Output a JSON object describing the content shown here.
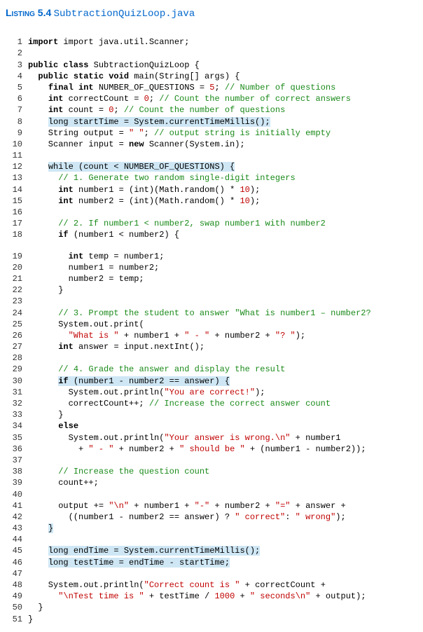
{
  "header": {
    "label": "Listing 5.4",
    "file": "SubtractionQuizLoop.java"
  },
  "lines": {
    "l1": "import java.util.Scanner;",
    "l3": "public class SubtractionQuizLoop {",
    "l4": "public static void main(String[] args) {",
    "l5a": "final int NUMBER_OF_QUESTIONS = ",
    "l5b": "5",
    "l5c": "; ",
    "l5d": "// Number of questions",
    "l6a": "int correctCount = ",
    "l6b": "0",
    "l6c": "; ",
    "l6d": "// Count the number of correct answers",
    "l7a": "int count = ",
    "l7b": "0",
    "l7c": "; ",
    "l7d": "// Count the number of questions",
    "l8": "long startTime = System.currentTimeMillis();",
    "l9a": "String output = ",
    "l9b": "\" \"",
    "l9c": "; ",
    "l9d": "// output string is initially empty",
    "l10a": "Scanner input = ",
    "l10b": "new",
    "l10c": " Scanner(System.in);",
    "l12": "while (count < NUMBER_OF_QUESTIONS) {",
    "l13": "// 1. Generate two random single-digit integers",
    "l14a": "int number1 = (int)(Math.random() * ",
    "l14b": "10",
    "l14c": ");",
    "l15a": "int number2 = (int)(Math.random() * ",
    "l15b": "10",
    "l15c": ");",
    "l17": "// 2. If number1 < number2, swap number1 with number2",
    "l18a": "if",
    "l18b": " (number1 < number2) {",
    "l19": "int temp = number1;",
    "l20": "number1 = number2;",
    "l21": "number2 = temp;",
    "l22": "}",
    "l24": "// 3. Prompt the student to answer \"What is number1 – number2?",
    "l25": "System.out.print(",
    "l26a": "\"What is \"",
    "l26b": " + number1 + ",
    "l26c": "\" - \"",
    "l26d": " + number2 + ",
    "l26e": "\"? \"",
    "l26f": ");",
    "l27": "int answer = input.nextInt();",
    "l29": "// 4. Grade the answer and display the result",
    "l30a": "if",
    "l30b": " (number1 - number2 == answer) {",
    "l31a": "System.out.println(",
    "l31b": "\"You are correct!\"",
    "l31c": ");",
    "l32a": "correctCount++; ",
    "l32b": "// Increase the correct answer count",
    "l33": "}",
    "l34": "else",
    "l35a": "System.out.println(",
    "l35b": "\"Your answer is wrong.\\n\"",
    "l35c": " + number1",
    "l36a": "+ ",
    "l36b": "\" - \"",
    "l36c": " + number2 + ",
    "l36d": "\" should be \"",
    "l36e": " + (number1 - number2));",
    "l38": "// Increase the question count",
    "l39": "count++;",
    "l41a": "output += ",
    "l41b": "\"\\n\"",
    "l41c": " + number1 + ",
    "l41d": "\"-\"",
    "l41e": " + number2 + ",
    "l41f": "\"=\"",
    "l41g": " + answer +",
    "l42a": "((number1 - number2 == answer) ? ",
    "l42b": "\" correct\"",
    "l42c": ": ",
    "l42d": "\" wrong\"",
    "l42e": ");",
    "l43": "}",
    "l45": "long endTime = System.currentTimeMillis();",
    "l46": "long testTime = endTime - startTime;",
    "l48a": "System.out.println(",
    "l48b": "\"Correct count is \"",
    "l48c": " + correctCount +",
    "l49a": "\"\\nTest time is \"",
    "l49b": " + testTime / ",
    "l49c": "1000",
    "l49d": " + ",
    "l49e": "\" seconds\\n\"",
    "l49f": " + output);",
    "l50": "}",
    "l51": "}"
  }
}
